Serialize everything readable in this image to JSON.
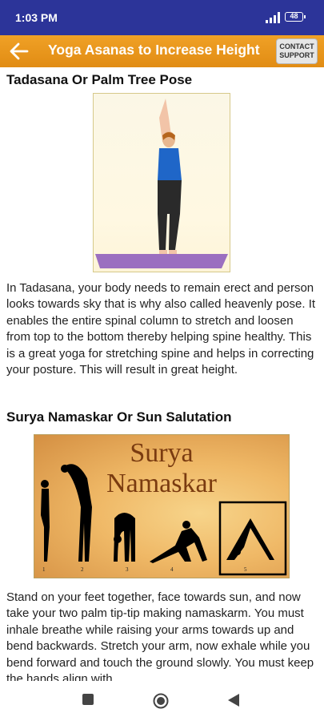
{
  "status_bar": {
    "time": "1:03 PM",
    "battery": "48",
    "icons": [
      "signal-icon",
      "battery-icon"
    ]
  },
  "app_bar": {
    "back_icon": "arrow-left-icon",
    "title": "Yoga Asanas to Increase Height",
    "contact_label_line1": "CONTACT",
    "contact_label_line2": "SUPPORT"
  },
  "sections": [
    {
      "heading": "Tadasana Or Palm Tree Pose",
      "body": "In Tadasana, your body needs to remain erect and person looks towards sky that is why also called heavenly pose. It enables the entire spinal column to stretch and loosen from top to the bottom thereby helping spine healthy. This is a great yoga for stretching spine and helps in correcting your posture. This will result in great height."
    },
    {
      "heading": "Surya Namaskar Or Sun Salutation",
      "image_title_line1": "Surya",
      "image_title_line2": "Namaskar",
      "step_numbers": [
        "1",
        "2",
        "3",
        "4",
        "5"
      ],
      "body": "Stand on your feet together, face towards sun, and now take your two palm tip-tip making namaskarm. You must inhale breathe while raising your arms towards up and bend backwards. Stretch your arm, now exhale while you bend forward and touch the ground slowly. You must keep the hands align with"
    }
  ],
  "nav_bar": {
    "icons": [
      "recents-square-icon",
      "home-circle-icon",
      "back-triangle-icon"
    ]
  },
  "colors": {
    "status_bar": "#2c3499",
    "app_bar": "#e99a1f",
    "mat": "#9b6fc0",
    "shirt": "#1f66c8",
    "silhouette": "#000000"
  }
}
